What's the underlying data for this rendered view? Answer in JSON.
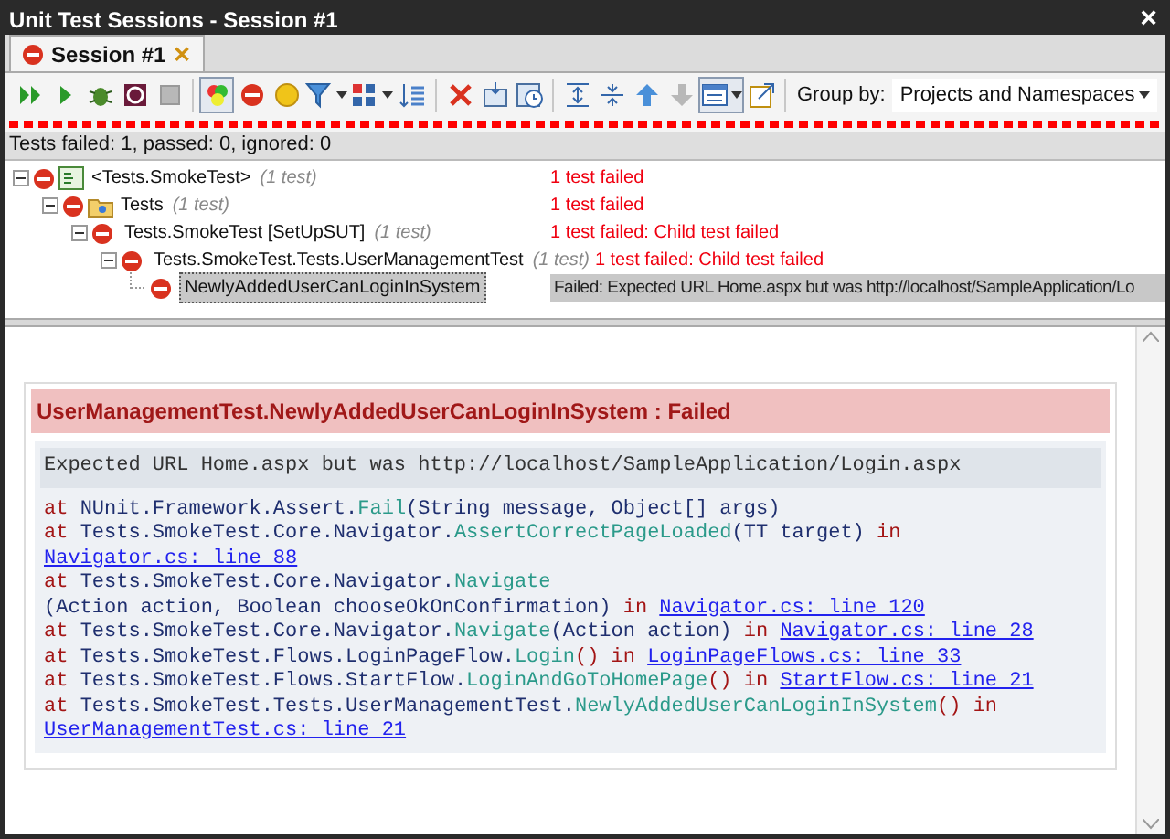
{
  "window": {
    "title": "Unit Test Sessions - Session #1",
    "close": "×"
  },
  "tabs": [
    {
      "label": "Session #1",
      "selected": true,
      "close": "✕"
    }
  ],
  "toolbar": [
    {
      "kind": "run-all",
      "selected": false
    },
    {
      "kind": "run",
      "selected": false
    },
    {
      "kind": "debug",
      "selected": false
    },
    {
      "kind": "profile",
      "selected": false
    },
    {
      "kind": "stop",
      "selected": false
    },
    {
      "kind": "sep"
    },
    {
      "kind": "show-all",
      "selected": true
    },
    {
      "kind": "failed",
      "selected": false
    },
    {
      "kind": "ignored",
      "selected": false
    },
    {
      "kind": "filter",
      "selected": false
    },
    {
      "kind": "grid",
      "selected": false
    },
    {
      "kind": "sort",
      "selected": false
    },
    {
      "kind": "sep"
    },
    {
      "kind": "delete",
      "selected": false
    },
    {
      "kind": "import",
      "selected": false
    },
    {
      "kind": "clock",
      "selected": false
    },
    {
      "kind": "sep"
    },
    {
      "kind": "expand",
      "selected": false
    },
    {
      "kind": "collapse",
      "selected": false
    },
    {
      "kind": "up",
      "selected": false
    },
    {
      "kind": "down",
      "selected": false
    },
    {
      "kind": "layout",
      "selected": true
    },
    {
      "kind": "external",
      "selected": false
    },
    {
      "kind": "sep"
    }
  ],
  "group_by": {
    "label": "Group by:",
    "value": "Projects and Namespaces"
  },
  "progress": {
    "level": 1,
    "failed": true
  },
  "status": "Tests failed: 1, passed: 0, ignored: 0",
  "tree": [
    {
      "kind": "project",
      "name": "<Tests.SmokeTest>",
      "count": "(1 test)",
      "result": "1 test failed",
      "failed": true,
      "selected": false,
      "children": [
        {
          "kind": "folder",
          "name": "Tests",
          "count": "(1 test)",
          "result": "1 test failed",
          "failed": true,
          "selected": false,
          "children": [
            {
              "name": "Tests.SmokeTest [SetUpSUT]",
              "count": "(1 test)",
              "result": "1 test failed: Child test failed",
              "failed": true,
              "selected": false,
              "children": [
                {
                  "name": "Tests.SmokeTest.Tests.UserManagementTest",
                  "count": "(1 test)",
                  "result": "1 test failed: Child test failed",
                  "failed": true,
                  "selected": false,
                  "children": [
                    {
                      "name": "NewlyAddedUserCanLoginInSystem",
                      "result": "Failed: Expected URL Home.aspx but was http://localhost/SampleApplication/Lo",
                      "failed": true,
                      "selected": true
                    }
                  ]
                }
              ]
            }
          ]
        }
      ]
    }
  ],
  "details": {
    "heading": "UserManagementTest.NewlyAddedUserCanLoginInSystem : Failed",
    "message": "Expected URL Home.aspx but was http://localhost/SampleApplication/Login.aspx",
    "stack": [
      [
        {
          "kind": "kw",
          "text": "at "
        },
        {
          "kind": "type",
          "text": "NUnit.Framework.Assert."
        },
        {
          "kind": "method",
          "text": "Fail"
        },
        {
          "kind": "type",
          "text": "(String message, Object[] args)"
        }
      ],
      [
        {
          "kind": "kw",
          "text": "at "
        },
        {
          "kind": "type",
          "text": "Tests.SmokeTest.Core.Navigator."
        },
        {
          "kind": "method",
          "text": "AssertCorrectPageLoaded"
        },
        {
          "kind": "type",
          "text": "(TT target)"
        },
        {
          "kind": "kw",
          "text": " in"
        }
      ],
      [
        {
          "kind": "link",
          "text": "Navigator.cs: line 88"
        }
      ],
      [
        {
          "kind": "kw",
          "text": "at "
        },
        {
          "kind": "type",
          "text": "Tests.SmokeTest.Core.Navigator."
        },
        {
          "kind": "method",
          "text": "Navigate"
        }
      ],
      [
        {
          "kind": "type",
          "text": "(Action action, Boolean chooseOkOnConfirmation)"
        },
        {
          "kind": "kw",
          "text": " in "
        },
        {
          "kind": "link",
          "text": "Navigator.cs: line 120"
        }
      ],
      [
        {
          "kind": "kw",
          "text": "at "
        },
        {
          "kind": "type",
          "text": "Tests.SmokeTest.Core.Navigator."
        },
        {
          "kind": "method",
          "text": "Navigate"
        },
        {
          "kind": "type",
          "text": "(Action action)"
        },
        {
          "kind": "kw",
          "text": " in "
        },
        {
          "kind": "link",
          "text": "Navigator.cs: line 28"
        }
      ],
      [
        {
          "kind": "kw",
          "text": "at "
        },
        {
          "kind": "type",
          "text": "Tests.SmokeTest.Flows.LoginPageFlow."
        },
        {
          "kind": "method",
          "text": "Login"
        },
        {
          "kind": "kw",
          "text": "() in "
        },
        {
          "kind": "link",
          "text": "LoginPageFlows.cs: line 33"
        }
      ],
      [
        {
          "kind": "kw",
          "text": "at "
        },
        {
          "kind": "type",
          "text": "Tests.SmokeTest.Flows.StartFlow."
        },
        {
          "kind": "method",
          "text": "LoginAndGoToHomePage"
        },
        {
          "kind": "kw",
          "text": "() in "
        },
        {
          "kind": "link",
          "text": "StartFlow.cs: line 21"
        }
      ],
      [
        {
          "kind": "kw",
          "text": "at "
        },
        {
          "kind": "type",
          "text": "Tests.SmokeTest.Tests.UserManagementTest."
        },
        {
          "kind": "method",
          "text": "NewlyAddedUserCanLoginInSystem"
        },
        {
          "kind": "kw",
          "text": "() in"
        }
      ],
      [
        {
          "kind": "link",
          "text": "UserManagementTest.cs: line 21"
        }
      ]
    ]
  }
}
